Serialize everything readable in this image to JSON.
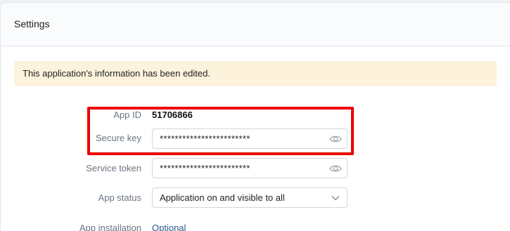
{
  "header": {
    "title": "Settings"
  },
  "notice": {
    "text": "This application's information has been edited."
  },
  "form": {
    "app_id": {
      "label": "App ID",
      "value": "51706866"
    },
    "secure_key": {
      "label": "Secure key",
      "value": "************************",
      "icon": "eye-icon"
    },
    "service_token": {
      "label": "Service token",
      "value": "************************",
      "icon": "eye-icon"
    },
    "app_status": {
      "label": "App status",
      "selected": "Application on and visible to all",
      "icon": "chevron-down-icon"
    },
    "app_installation": {
      "label": "App installation",
      "link": "Optional"
    }
  },
  "colors": {
    "highlight": "#ee0000",
    "notice_bg": "#fdf3dc",
    "link": "#2a5885",
    "label": "#6b7480"
  }
}
